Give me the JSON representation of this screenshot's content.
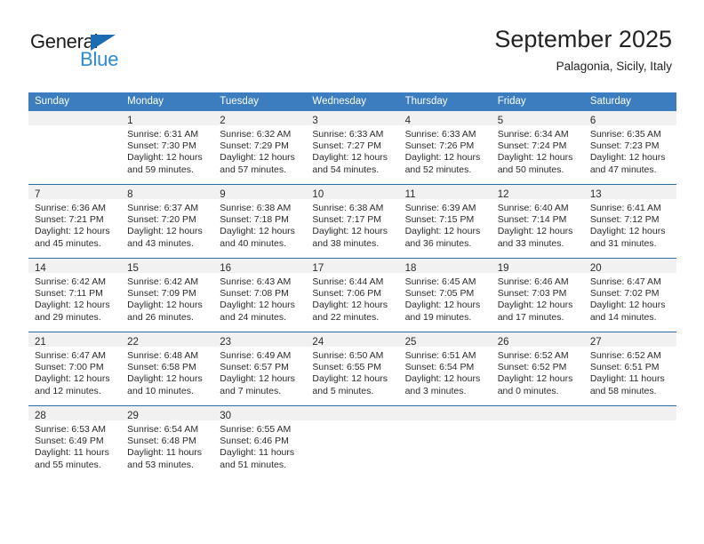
{
  "brand": {
    "name_top": "General",
    "name_bottom": "Blue",
    "accent_dark": "#1b6cb3",
    "accent_light": "#2d8ad4"
  },
  "header": {
    "title": "September 2025",
    "subtitle": "Palagonia, Sicily, Italy"
  },
  "theme": {
    "header_row_bg": "#3b7dbf",
    "week_separator": "#2e6da8",
    "daynum_band_bg": "#f1f1f1",
    "text": "#2b2b2b"
  },
  "weekday_headers": [
    "Sunday",
    "Monday",
    "Tuesday",
    "Wednesday",
    "Thursday",
    "Friday",
    "Saturday"
  ],
  "weeks": [
    [
      {
        "day": "",
        "lines": []
      },
      {
        "day": "1",
        "lines": [
          "Sunrise: 6:31 AM",
          "Sunset: 7:30 PM",
          "Daylight: 12 hours",
          "and 59 minutes."
        ]
      },
      {
        "day": "2",
        "lines": [
          "Sunrise: 6:32 AM",
          "Sunset: 7:29 PM",
          "Daylight: 12 hours",
          "and 57 minutes."
        ]
      },
      {
        "day": "3",
        "lines": [
          "Sunrise: 6:33 AM",
          "Sunset: 7:27 PM",
          "Daylight: 12 hours",
          "and 54 minutes."
        ]
      },
      {
        "day": "4",
        "lines": [
          "Sunrise: 6:33 AM",
          "Sunset: 7:26 PM",
          "Daylight: 12 hours",
          "and 52 minutes."
        ]
      },
      {
        "day": "5",
        "lines": [
          "Sunrise: 6:34 AM",
          "Sunset: 7:24 PM",
          "Daylight: 12 hours",
          "and 50 minutes."
        ]
      },
      {
        "day": "6",
        "lines": [
          "Sunrise: 6:35 AM",
          "Sunset: 7:23 PM",
          "Daylight: 12 hours",
          "and 47 minutes."
        ]
      }
    ],
    [
      {
        "day": "7",
        "lines": [
          "Sunrise: 6:36 AM",
          "Sunset: 7:21 PM",
          "Daylight: 12 hours",
          "and 45 minutes."
        ]
      },
      {
        "day": "8",
        "lines": [
          "Sunrise: 6:37 AM",
          "Sunset: 7:20 PM",
          "Daylight: 12 hours",
          "and 43 minutes."
        ]
      },
      {
        "day": "9",
        "lines": [
          "Sunrise: 6:38 AM",
          "Sunset: 7:18 PM",
          "Daylight: 12 hours",
          "and 40 minutes."
        ]
      },
      {
        "day": "10",
        "lines": [
          "Sunrise: 6:38 AM",
          "Sunset: 7:17 PM",
          "Daylight: 12 hours",
          "and 38 minutes."
        ]
      },
      {
        "day": "11",
        "lines": [
          "Sunrise: 6:39 AM",
          "Sunset: 7:15 PM",
          "Daylight: 12 hours",
          "and 36 minutes."
        ]
      },
      {
        "day": "12",
        "lines": [
          "Sunrise: 6:40 AM",
          "Sunset: 7:14 PM",
          "Daylight: 12 hours",
          "and 33 minutes."
        ]
      },
      {
        "day": "13",
        "lines": [
          "Sunrise: 6:41 AM",
          "Sunset: 7:12 PM",
          "Daylight: 12 hours",
          "and 31 minutes."
        ]
      }
    ],
    [
      {
        "day": "14",
        "lines": [
          "Sunrise: 6:42 AM",
          "Sunset: 7:11 PM",
          "Daylight: 12 hours",
          "and 29 minutes."
        ]
      },
      {
        "day": "15",
        "lines": [
          "Sunrise: 6:42 AM",
          "Sunset: 7:09 PM",
          "Daylight: 12 hours",
          "and 26 minutes."
        ]
      },
      {
        "day": "16",
        "lines": [
          "Sunrise: 6:43 AM",
          "Sunset: 7:08 PM",
          "Daylight: 12 hours",
          "and 24 minutes."
        ]
      },
      {
        "day": "17",
        "lines": [
          "Sunrise: 6:44 AM",
          "Sunset: 7:06 PM",
          "Daylight: 12 hours",
          "and 22 minutes."
        ]
      },
      {
        "day": "18",
        "lines": [
          "Sunrise: 6:45 AM",
          "Sunset: 7:05 PM",
          "Daylight: 12 hours",
          "and 19 minutes."
        ]
      },
      {
        "day": "19",
        "lines": [
          "Sunrise: 6:46 AM",
          "Sunset: 7:03 PM",
          "Daylight: 12 hours",
          "and 17 minutes."
        ]
      },
      {
        "day": "20",
        "lines": [
          "Sunrise: 6:47 AM",
          "Sunset: 7:02 PM",
          "Daylight: 12 hours",
          "and 14 minutes."
        ]
      }
    ],
    [
      {
        "day": "21",
        "lines": [
          "Sunrise: 6:47 AM",
          "Sunset: 7:00 PM",
          "Daylight: 12 hours",
          "and 12 minutes."
        ]
      },
      {
        "day": "22",
        "lines": [
          "Sunrise: 6:48 AM",
          "Sunset: 6:58 PM",
          "Daylight: 12 hours",
          "and 10 minutes."
        ]
      },
      {
        "day": "23",
        "lines": [
          "Sunrise: 6:49 AM",
          "Sunset: 6:57 PM",
          "Daylight: 12 hours",
          "and 7 minutes."
        ]
      },
      {
        "day": "24",
        "lines": [
          "Sunrise: 6:50 AM",
          "Sunset: 6:55 PM",
          "Daylight: 12 hours",
          "and 5 minutes."
        ]
      },
      {
        "day": "25",
        "lines": [
          "Sunrise: 6:51 AM",
          "Sunset: 6:54 PM",
          "Daylight: 12 hours",
          "and 3 minutes."
        ]
      },
      {
        "day": "26",
        "lines": [
          "Sunrise: 6:52 AM",
          "Sunset: 6:52 PM",
          "Daylight: 12 hours",
          "and 0 minutes."
        ]
      },
      {
        "day": "27",
        "lines": [
          "Sunrise: 6:52 AM",
          "Sunset: 6:51 PM",
          "Daylight: 11 hours",
          "and 58 minutes."
        ]
      }
    ],
    [
      {
        "day": "28",
        "lines": [
          "Sunrise: 6:53 AM",
          "Sunset: 6:49 PM",
          "Daylight: 11 hours",
          "and 55 minutes."
        ]
      },
      {
        "day": "29",
        "lines": [
          "Sunrise: 6:54 AM",
          "Sunset: 6:48 PM",
          "Daylight: 11 hours",
          "and 53 minutes."
        ]
      },
      {
        "day": "30",
        "lines": [
          "Sunrise: 6:55 AM",
          "Sunset: 6:46 PM",
          "Daylight: 11 hours",
          "and 51 minutes."
        ]
      },
      {
        "day": "",
        "lines": []
      },
      {
        "day": "",
        "lines": []
      },
      {
        "day": "",
        "lines": []
      },
      {
        "day": "",
        "lines": []
      }
    ]
  ]
}
